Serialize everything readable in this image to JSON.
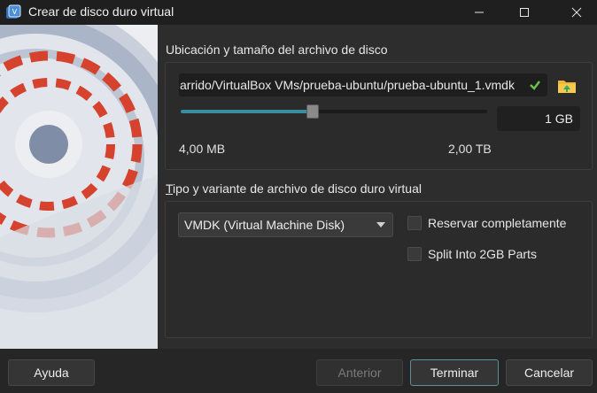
{
  "window": {
    "title": "Crear de disco duro virtual",
    "controls": [
      "minimize-icon",
      "maximize-icon",
      "close-icon"
    ]
  },
  "location_group": {
    "title": "Ubicación y tamaño del archivo de disco",
    "file_path": "arrido/VirtualBox VMs/prueba-ubuntu/prueba-ubuntu_1.vmdk",
    "folder_button_icon": "folder-icon",
    "size_value": "1 GB",
    "slider_fraction": 0.43,
    "range_min": "4,00 MB",
    "range_max": "2,00 TB"
  },
  "type_group": {
    "title": "Tipo y variante de archivo de disco duro virtual",
    "format_selected": "VMDK (Virtual Machine Disk)",
    "preallocate_label": "Reservar completamente",
    "preallocate_checked": false,
    "split_label": "Split Into 2GB Parts",
    "split_checked": false
  },
  "buttons": {
    "help": "Ayuda",
    "back": "Anterior",
    "finish": "Terminar",
    "cancel": "Cancelar"
  },
  "colors": {
    "accent": "#3a8ea0",
    "background": "#2b2b2b"
  }
}
